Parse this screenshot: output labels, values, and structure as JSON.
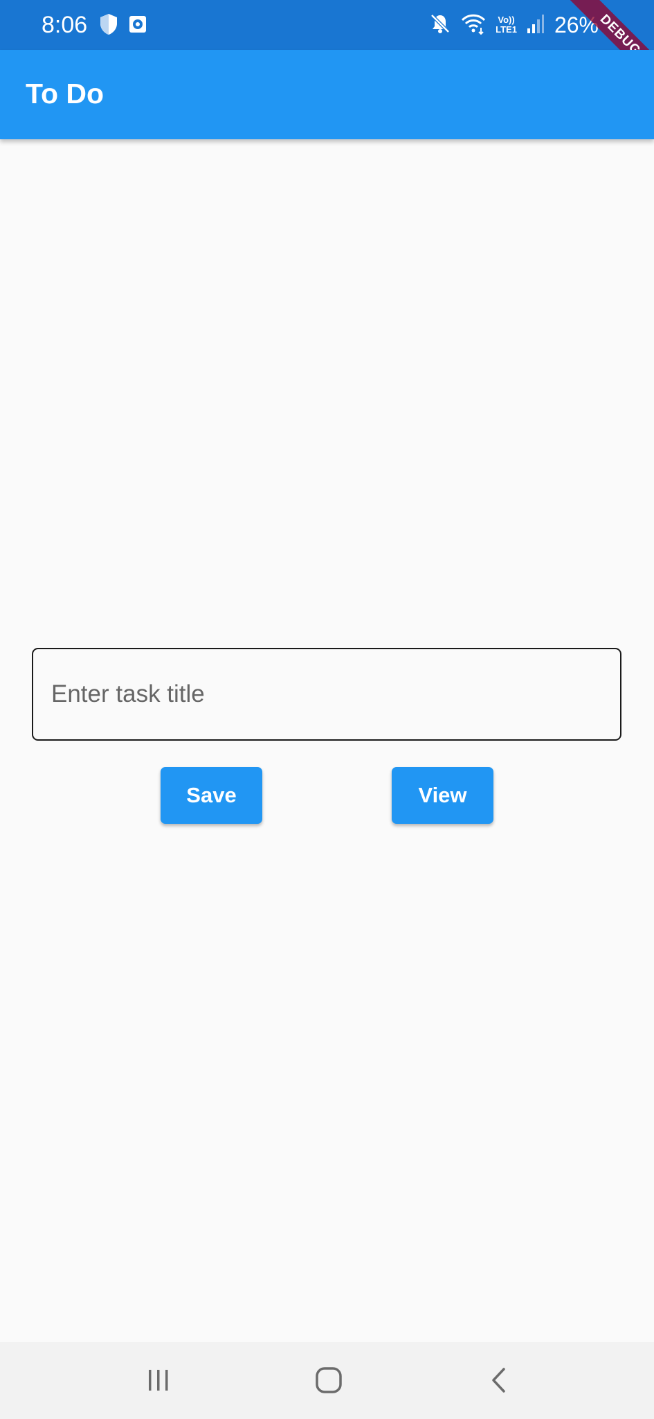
{
  "status_bar": {
    "time": "8:06",
    "battery_percent": "26%",
    "network_label_top": "Vo))",
    "network_label_bottom": "LTE1",
    "icons": [
      "shield-icon",
      "screenshot-icon",
      "mute-icon",
      "wifi-icon",
      "lte-icon",
      "signal-icon"
    ]
  },
  "debug_banner": {
    "label": "DEBUG"
  },
  "app_bar": {
    "title": "To Do"
  },
  "task_form": {
    "input": {
      "value": "",
      "placeholder": "Enter task title"
    },
    "save_label": "Save",
    "view_label": "View"
  },
  "nav_bar": {
    "icons": [
      "recents-icon",
      "home-icon",
      "back-icon"
    ]
  },
  "colors": {
    "status_bar": "#1976d2",
    "app_bar": "#2196f3",
    "button": "#2196f3",
    "background": "#fafafa",
    "nav_bar": "#f2f2f2"
  }
}
